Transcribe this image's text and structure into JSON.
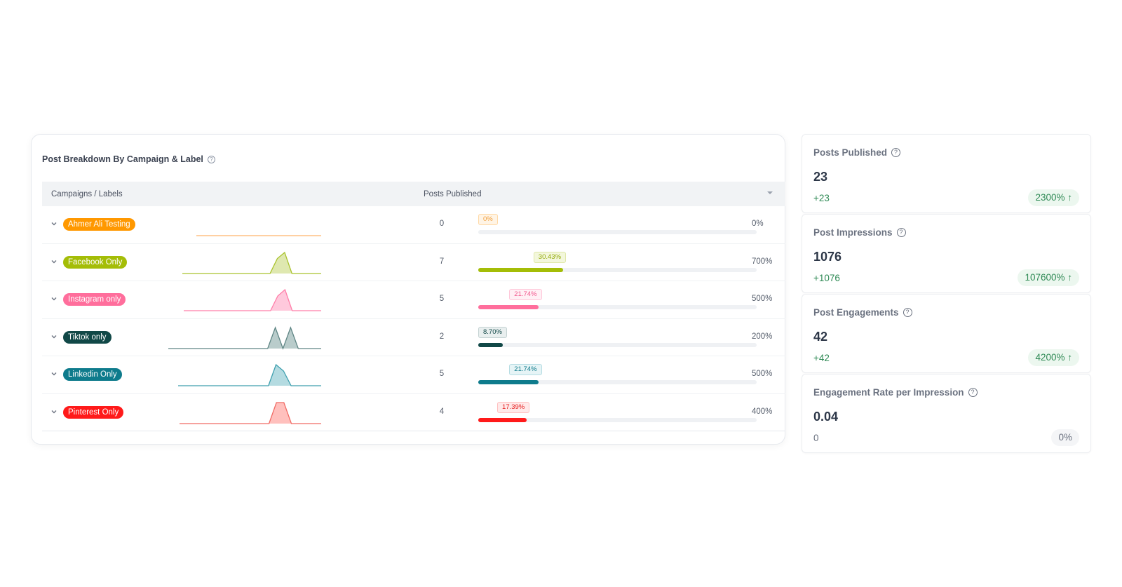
{
  "breakdown": {
    "title": "Post Breakdown By Campaign & Label",
    "help_icon": "question-circle-icon",
    "columns": {
      "campaign": "Campaigns / Labels",
      "posts": "Posts Published"
    },
    "rows": [
      {
        "label": "Ahmer Ali Testing",
        "color": "#ff9800",
        "tag_bg": "#fff4e5",
        "tag_border": "#ffd9a6",
        "tag_text": "#f0a040",
        "count": "0",
        "share": "0%",
        "share_value": 0,
        "growth": "0%",
        "spark": [
          0,
          0,
          0,
          0,
          0,
          0,
          0,
          0,
          0,
          0,
          0,
          0,
          0,
          0,
          0,
          0,
          0,
          0,
          0,
          0
        ],
        "spark_fill": "#ffd9a6",
        "spark_line": "#ffb36b"
      },
      {
        "label": "Facebook Only",
        "color": "#a4bd07",
        "tag_bg": "#f3f7dc",
        "tag_border": "#dfe8a8",
        "tag_text": "#93aa0a",
        "count": "7",
        "share": "30.43%",
        "share_value": 30.43,
        "growth": "700%",
        "spark": [
          0,
          0,
          0,
          0,
          0,
          0,
          0,
          0,
          0,
          0,
          0,
          0,
          0,
          5,
          7,
          0,
          0,
          0,
          0,
          0
        ],
        "spark_fill": "#dfe8b0",
        "spark_line": "#a9c22c"
      },
      {
        "label": "Instagram only",
        "color": "#ff6e9c",
        "tag_bg": "#fff0f5",
        "tag_border": "#ffc7d9",
        "tag_text": "#f25a8f",
        "count": "5",
        "share": "21.74%",
        "share_value": 21.74,
        "growth": "500%",
        "spark": [
          0,
          0,
          0,
          0,
          0,
          0,
          0,
          0,
          0,
          0,
          0,
          0,
          0,
          3.5,
          5,
          0,
          0,
          0,
          0,
          0
        ],
        "spark_fill": "#ffc9dc",
        "spark_line": "#ff7ea9"
      },
      {
        "label": "Tiktok only",
        "color": "#114847",
        "tag_bg": "#e9efef",
        "tag_border": "#c4d2d2",
        "tag_text": "#114847",
        "count": "2",
        "share": "8.70%",
        "share_value": 8.7,
        "growth": "200%",
        "spark": [
          0,
          0,
          0,
          0,
          0,
          0,
          0,
          0,
          0,
          0,
          0,
          0,
          0,
          0,
          1,
          0,
          1,
          0,
          0,
          0,
          0
        ],
        "spark_fill": "#b9cccb",
        "spark_line": "#5e8584"
      },
      {
        "label": "Linkedin Only",
        "color": "#0e7b8c",
        "tag_bg": "#e6f4f6",
        "tag_border": "#b6dde3",
        "tag_text": "#0e7b8c",
        "count": "5",
        "share": "21.74%",
        "share_value": 21.74,
        "growth": "500%",
        "spark": [
          0,
          0,
          0,
          0,
          0,
          0,
          0,
          0,
          0,
          0,
          0,
          0,
          0,
          5,
          3.5,
          0,
          0,
          0,
          0,
          0
        ],
        "spark_fill": "#b4dbe1",
        "spark_line": "#3e9fae"
      },
      {
        "label": "Pinterest Only",
        "color": "#ff1a1a",
        "tag_bg": "#ffe9e9",
        "tag_border": "#ffc0c0",
        "tag_text": "#e62020",
        "count": "4",
        "share": "17.39%",
        "share_value": 17.39,
        "growth": "400%",
        "spark": [
          0,
          0,
          0,
          0,
          0,
          0,
          0,
          0,
          0,
          0,
          0,
          0,
          0,
          4,
          4,
          0,
          0,
          0,
          0,
          0
        ],
        "spark_fill": "#ffc0bd",
        "spark_line": "#f06a64"
      }
    ]
  },
  "stats": [
    {
      "title": "Posts Published",
      "value": "23",
      "delta": "+23",
      "badge": "2300% ↑",
      "trend": "up"
    },
    {
      "title": "Post Impressions",
      "value": "1076",
      "delta": "+1076",
      "badge": "107600% ↑",
      "trend": "up"
    },
    {
      "title": "Post Engagements",
      "value": "42",
      "delta": "+42",
      "badge": "4200% ↑",
      "trend": "up"
    },
    {
      "title": "Engagement Rate per Impression",
      "value": "0.04",
      "delta": "0",
      "badge": "0%",
      "trend": "neutral"
    }
  ]
}
